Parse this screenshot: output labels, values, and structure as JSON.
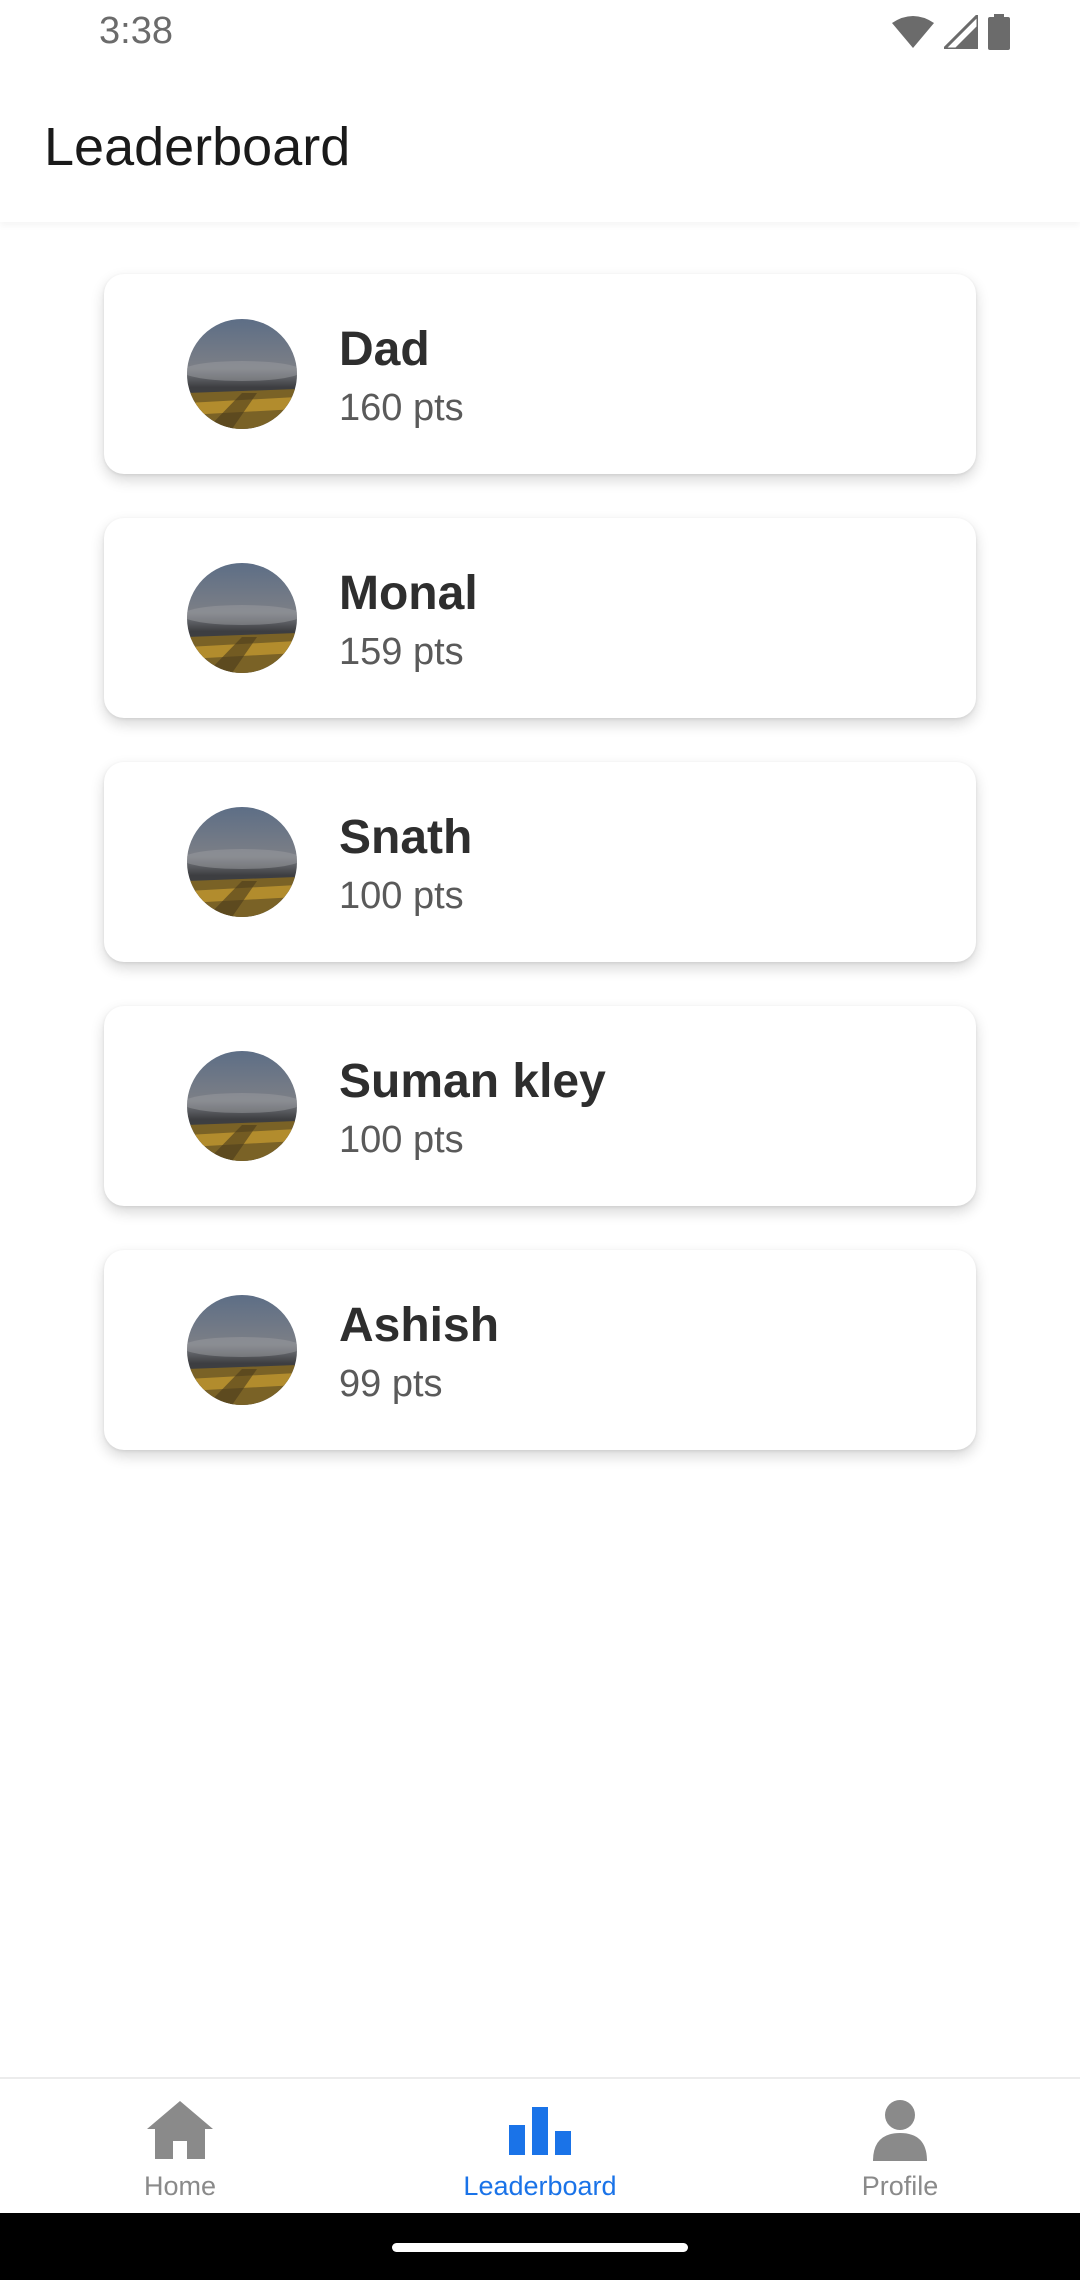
{
  "status_bar": {
    "time": "3:38"
  },
  "header": {
    "title": "Leaderboard"
  },
  "leaderboard": [
    {
      "name": "Dad",
      "points": "160 pts"
    },
    {
      "name": "Monal",
      "points": "159 pts"
    },
    {
      "name": "Snath",
      "points": "100 pts"
    },
    {
      "name": "Suman kley",
      "points": "100 pts"
    },
    {
      "name": "Ashish",
      "points": "99 pts"
    }
  ],
  "bottom_nav": {
    "items": [
      {
        "label": "Home",
        "icon": "home-icon"
      },
      {
        "label": "Leaderboard",
        "icon": "bar-chart-icon"
      },
      {
        "label": "Profile",
        "icon": "person-icon"
      }
    ],
    "active_color": "#1a73e8",
    "inactive_color": "#8a8a8a"
  }
}
